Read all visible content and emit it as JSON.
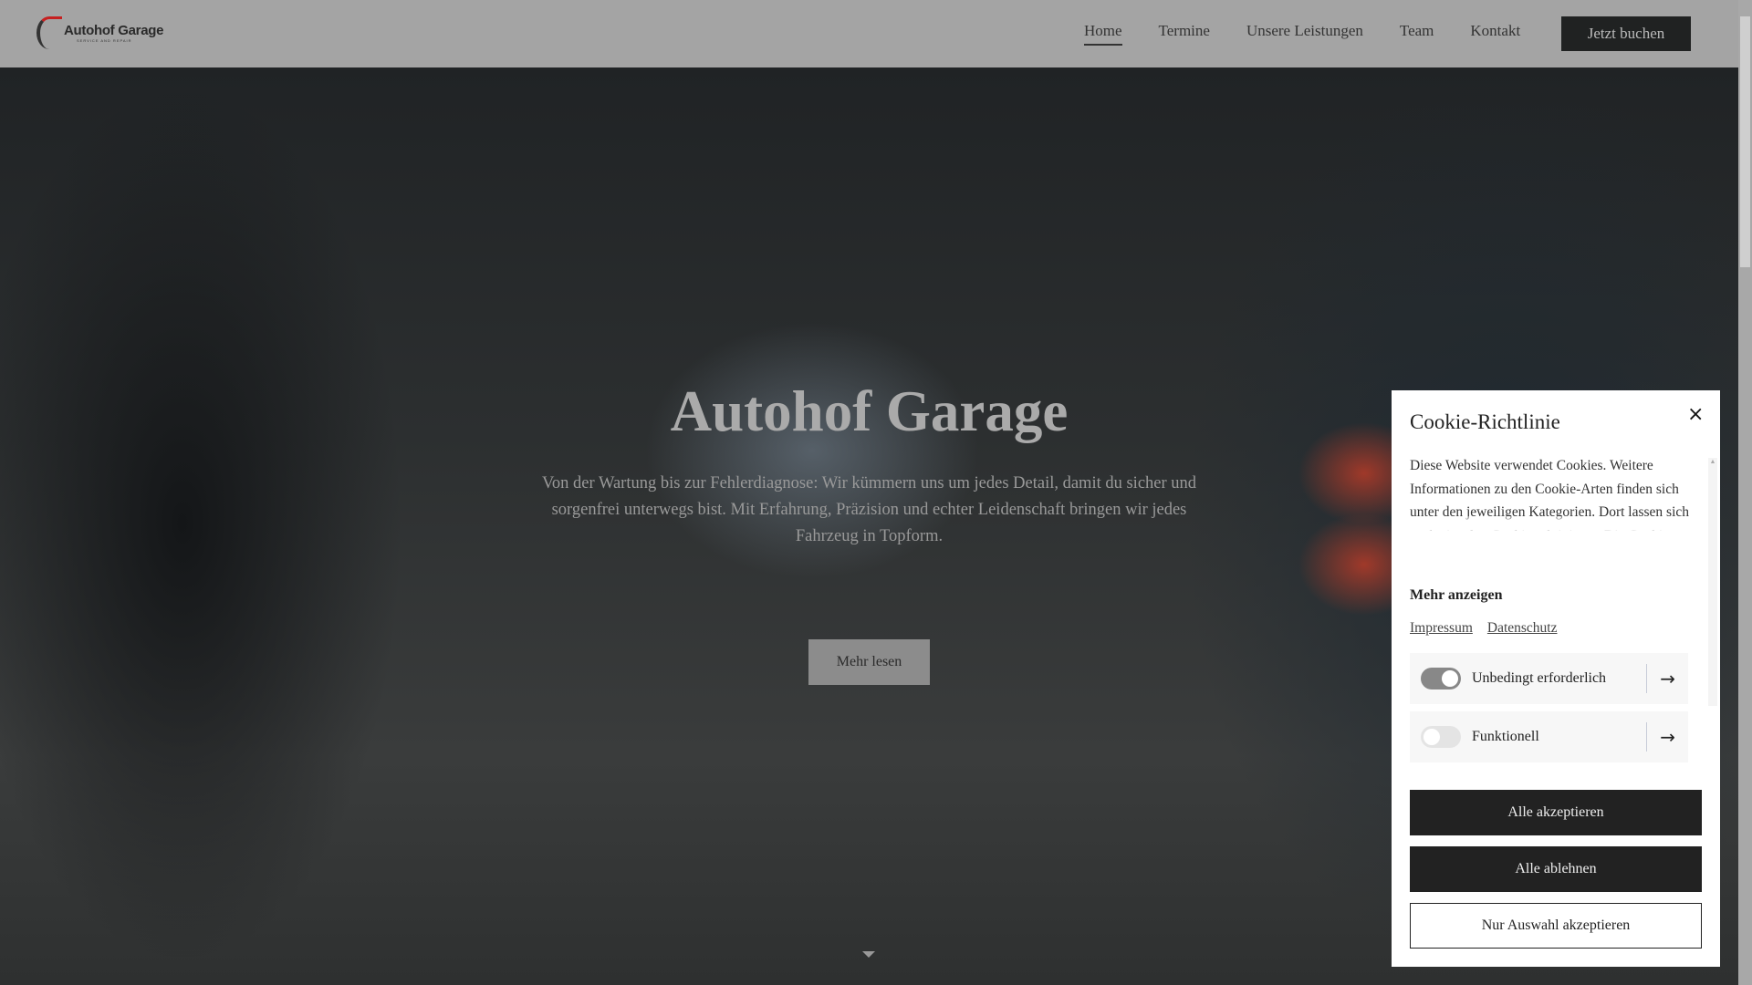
{
  "header": {
    "logo_text": "Autohof Garage",
    "logo_tagline": "SERVICE AND REPAIR",
    "nav": [
      {
        "label": "Home",
        "active": true
      },
      {
        "label": "Termine"
      },
      {
        "label": "Unsere Leistungen"
      },
      {
        "label": "Team"
      },
      {
        "label": "Kontakt"
      }
    ],
    "cta": "Jetzt buchen"
  },
  "hero": {
    "title": "Autohof Garage",
    "text": "Von der Wartung bis zur Fehlerdiagnose: Wir kümmern uns um jedes Detail, damit du sicher und sorgenfrei unterwegs bist. Mit Erfahrung, Präzision und echter Leidenschaft bringen wir jedes Fahrzeug in Topform.",
    "button": "Mehr lesen"
  },
  "cookie": {
    "title": "Cookie-Richtlinie",
    "close": "×",
    "text": "Diese Website verwendet Cookies. Weitere Informationen zu den Cookie-Arten finden sich unter den jeweiligen Kategorien. Dort lassen sich auch einzelne Cookies aktivieren. Die Cookie-Einstellungen können jederzeit über",
    "show_more": "Mehr anzeigen",
    "links": [
      "Impressum",
      "Datenschutz"
    ],
    "categories": [
      {
        "label": "Unbedingt erforderlich",
        "enabled": true
      },
      {
        "label": "Funktionell",
        "enabled": false
      }
    ],
    "accept_all": "Alle akzeptieren",
    "reject_all": "Alle ablehnen",
    "accept_selected": "Nur Auswahl akzeptieren"
  }
}
